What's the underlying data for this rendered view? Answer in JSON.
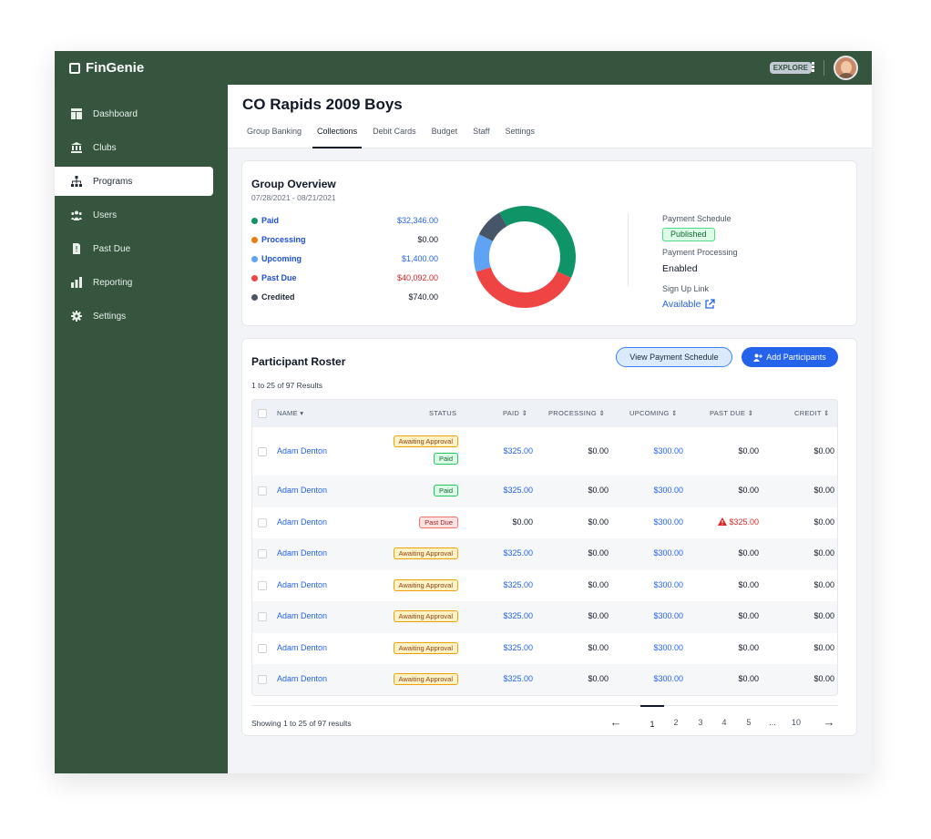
{
  "app": {
    "name": "FinGenie",
    "explore_label": "EXPLORE"
  },
  "sidebar": {
    "items": [
      {
        "label": "Dashboard",
        "icon": "dashboard-icon"
      },
      {
        "label": "Clubs",
        "icon": "building-icon"
      },
      {
        "label": "Programs",
        "icon": "hierarchy-icon",
        "active": true
      },
      {
        "label": "Users",
        "icon": "users-icon"
      },
      {
        "label": "Past Due",
        "icon": "alert-document-icon"
      },
      {
        "label": "Reporting",
        "icon": "bar-chart-icon"
      },
      {
        "label": "Settings",
        "icon": "gear-icon"
      }
    ]
  },
  "page": {
    "title": "CO Rapids 2009 Boys",
    "tabs": [
      "Group Banking",
      "Collections",
      "Debit Cards",
      "Budget",
      "Staff",
      "Settings"
    ],
    "active_tab": "Collections"
  },
  "overview": {
    "title": "Group Overview",
    "date_range": "07/28/2021 - 08/21/2021",
    "legend": [
      {
        "label": "Paid",
        "value": "$32,346.00",
        "color": "#0f9467",
        "label_color": "#1d4ed8",
        "value_color": "#2563eb"
      },
      {
        "label": "Processing",
        "value": "$0.00",
        "color": "#ea7a12",
        "label_color": "#1d4ed8",
        "value_color": "#111827"
      },
      {
        "label": "Upcoming",
        "value": "$1,400.00",
        "color": "#5fa3f5",
        "label_color": "#1d4ed8",
        "value_color": "#2563eb"
      },
      {
        "label": "Past Due",
        "value": "$40,092.00",
        "color": "#ef4444",
        "label_color": "#1d4ed8",
        "value_color": "#dc2626"
      },
      {
        "label": "Credited",
        "value": "$740.00",
        "color": "#4b5563",
        "label_color": "#1f2937",
        "value_color": "#111827"
      }
    ],
    "donut_segments": [
      {
        "name": "Paid",
        "fraction": 0.4,
        "color": "#0f9467"
      },
      {
        "name": "Past Due",
        "fraction": 0.385,
        "color": "#ef4444"
      },
      {
        "name": "Upcoming",
        "fraction": 0.12,
        "color": "#5fa3f5"
      },
      {
        "name": "Credited",
        "fraction": 0.095,
        "color": "#475569"
      }
    ],
    "payment_schedule_label": "Payment Schedule",
    "payment_schedule_status": "Published",
    "payment_processing_label": "Payment Processing",
    "payment_processing_value": "Enabled",
    "signup_label": "Sign Up Link",
    "signup_value": "Available"
  },
  "roster": {
    "title": "Participant Roster",
    "results_label": "1 to 25 of 97 Results",
    "view_schedule_button": "View Payment Schedule",
    "add_participants_button": "Add Participants",
    "columns": [
      "NAME",
      "STATUS",
      "PAID",
      "PROCESSING",
      "UPCOMING",
      "PAST DUE",
      "CREDIT"
    ],
    "rows": [
      {
        "name": "Adam Denton",
        "statuses": [
          "Awaiting Approval",
          "Paid"
        ],
        "paid": "$325.00",
        "processing": "$0.00",
        "upcoming": "$300.00",
        "past_due": "$0.00",
        "credit": "$0.00"
      },
      {
        "name": "Adam Denton",
        "statuses": [
          "Paid"
        ],
        "paid": "$325.00",
        "processing": "$0.00",
        "upcoming": "$300.00",
        "past_due": "$0.00",
        "credit": "$0.00"
      },
      {
        "name": "Adam Denton",
        "statuses": [
          "Past Due"
        ],
        "paid": "$0.00",
        "processing": "$0.00",
        "upcoming": "$300.00",
        "past_due": "$325.00",
        "credit": "$0.00"
      },
      {
        "name": "Adam Denton",
        "statuses": [
          "Awaiting Approval"
        ],
        "paid": "$325.00",
        "processing": "$0.00",
        "upcoming": "$300.00",
        "past_due": "$0.00",
        "credit": "$0.00"
      },
      {
        "name": "Adam Denton",
        "statuses": [
          "Awaiting Approval"
        ],
        "paid": "$325.00",
        "processing": "$0.00",
        "upcoming": "$300.00",
        "past_due": "$0.00",
        "credit": "$0.00"
      },
      {
        "name": "Adam Denton",
        "statuses": [
          "Awaiting Approval"
        ],
        "paid": "$325.00",
        "processing": "$0.00",
        "upcoming": "$300.00",
        "past_due": "$0.00",
        "credit": "$0.00"
      },
      {
        "name": "Adam Denton",
        "statuses": [
          "Awaiting Approval"
        ],
        "paid": "$325.00",
        "processing": "$0.00",
        "upcoming": "$300.00",
        "past_due": "$0.00",
        "credit": "$0.00"
      },
      {
        "name": "Adam Denton",
        "statuses": [
          "Awaiting Approval"
        ],
        "paid": "$325.00",
        "processing": "$0.00",
        "upcoming": "$300.00",
        "past_due": "$0.00",
        "credit": "$0.00"
      }
    ],
    "pagination": {
      "showing_label": "Showing 1 to 25 of 97 results",
      "pages": [
        "1",
        "2",
        "3",
        "4",
        "5",
        "...",
        "10"
      ],
      "current": "1",
      "prev_icon": "arrow-left-icon",
      "next_icon": "arrow-right-icon"
    }
  }
}
